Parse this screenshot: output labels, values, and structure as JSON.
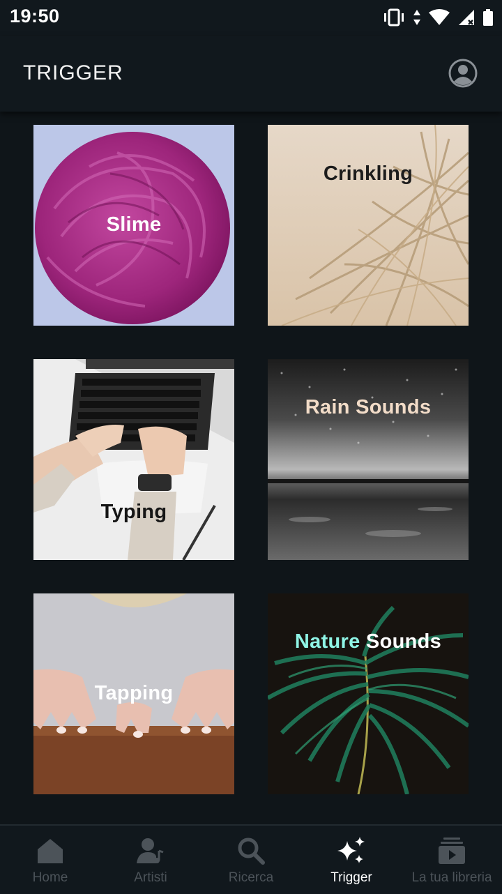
{
  "status_bar": {
    "time": "19:50"
  },
  "app_bar": {
    "title": "TRIGGER"
  },
  "tiles": [
    {
      "label": "Slime"
    },
    {
      "label": "Crinkling"
    },
    {
      "label": "Typing"
    },
    {
      "label": "Rain Sounds"
    },
    {
      "label": "Tapping"
    },
    {
      "label_part1": "Nature",
      "label_part2": " Sounds"
    }
  ],
  "bottom_nav": [
    {
      "label": "Home",
      "icon": "home-icon"
    },
    {
      "label": "Artisti",
      "icon": "artist-icon"
    },
    {
      "label": "Ricerca",
      "icon": "search-icon"
    },
    {
      "label": "Trigger",
      "icon": "sparkle-icon",
      "active": true
    },
    {
      "label": "La tua libreria",
      "icon": "library-icon"
    }
  ],
  "colors": {
    "background": "#0f1519",
    "bar": "#11181d",
    "inactive_nav": "#4c5359",
    "active_nav": "#ffffff",
    "nature_accent": "#8ff5e6"
  }
}
